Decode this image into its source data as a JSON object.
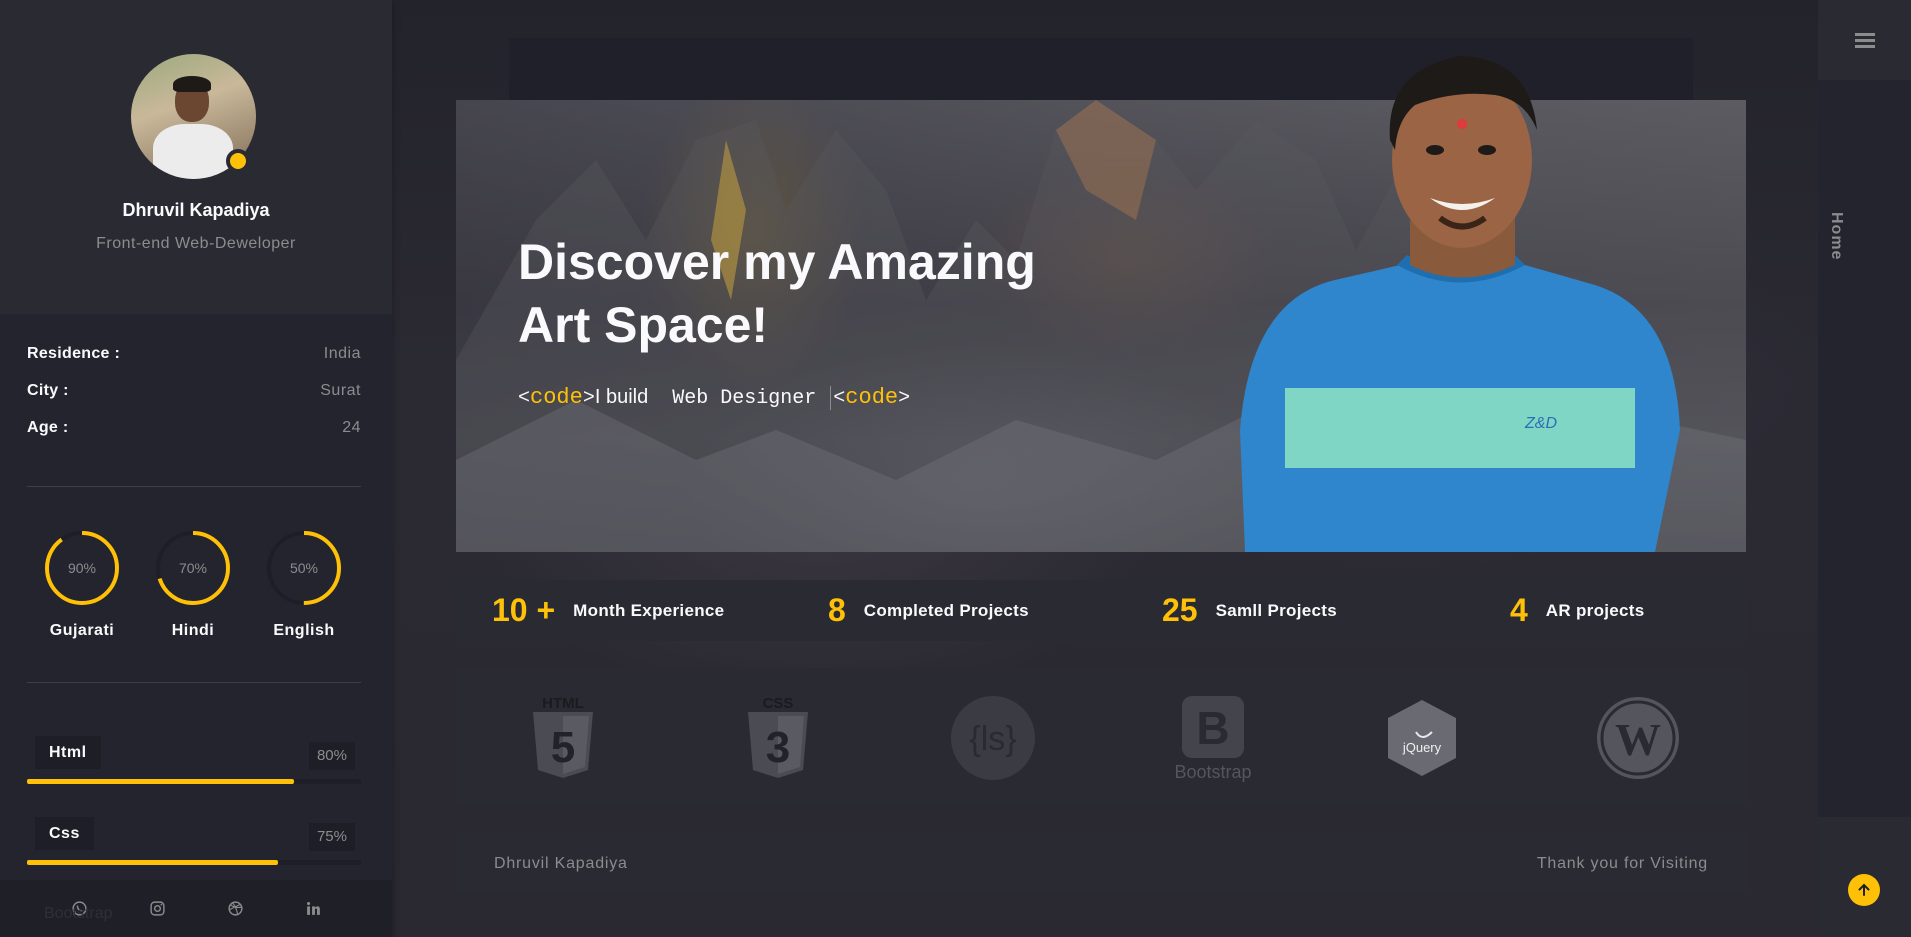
{
  "profile": {
    "name": "Dhruvil Kapadiya",
    "role": "Front-end Web-Deweloper"
  },
  "info": [
    {
      "key": "Residence :",
      "value": "India"
    },
    {
      "key": "City :",
      "value": "Surat"
    },
    {
      "key": "Age :",
      "value": "24"
    }
  ],
  "languages": [
    {
      "name": "Gujarati",
      "percent_label": "90%",
      "level": 0.9
    },
    {
      "name": "Hindi",
      "percent_label": "70%",
      "level": 0.7
    },
    {
      "name": "English",
      "percent_label": "50%",
      "level": 0.5
    }
  ],
  "skills": [
    {
      "name": "Html",
      "percent_label": "80%",
      "level": 0.8
    },
    {
      "name": "Css",
      "percent_label": "75%",
      "level": 0.75
    }
  ],
  "sidebar_footer": {
    "ghost_text": "Bootstrap",
    "social_icons": [
      "whatsapp-icon",
      "instagram-icon",
      "dribbble-icon",
      "linkedin-icon"
    ]
  },
  "rail": {
    "menu_icon": "hamburger-icon",
    "current_page": "Home",
    "scroll_top_icon": "arrow-up-icon"
  },
  "hero": {
    "title_line1": "Discover my Amazing",
    "title_line2": "Art Space!",
    "typed": {
      "open_bracket": "<",
      "code_word": "code",
      "close_bracket": ">",
      "lead": "I build",
      "typed_text": "Web Designer",
      "open_bracket_2": "<",
      "code_word_2": "code",
      "close_bracket_2": ">"
    }
  },
  "stats": [
    {
      "number": "10 +",
      "label": "Month Experience"
    },
    {
      "number": "8",
      "label": "Completed Projects"
    },
    {
      "number": "25",
      "label": "Samll Projects"
    },
    {
      "number": "4",
      "label": "AR projects"
    }
  ],
  "brands": {
    "html": "HTML",
    "html_digit": "5",
    "css": "CSS",
    "css_digit": "3",
    "less": "{ls}",
    "bootstrap_letter": "B",
    "bootstrap": "Bootstrap",
    "jquery": "jQuery",
    "wordpress": "W"
  },
  "footer": {
    "left": "Dhruvil Kapadiya",
    "right": "Thank you for Visiting"
  },
  "colors": {
    "accent": "#ffc107",
    "panel": "#2a2a33",
    "background": "#252530",
    "muted_text": "#8c8c8e"
  }
}
